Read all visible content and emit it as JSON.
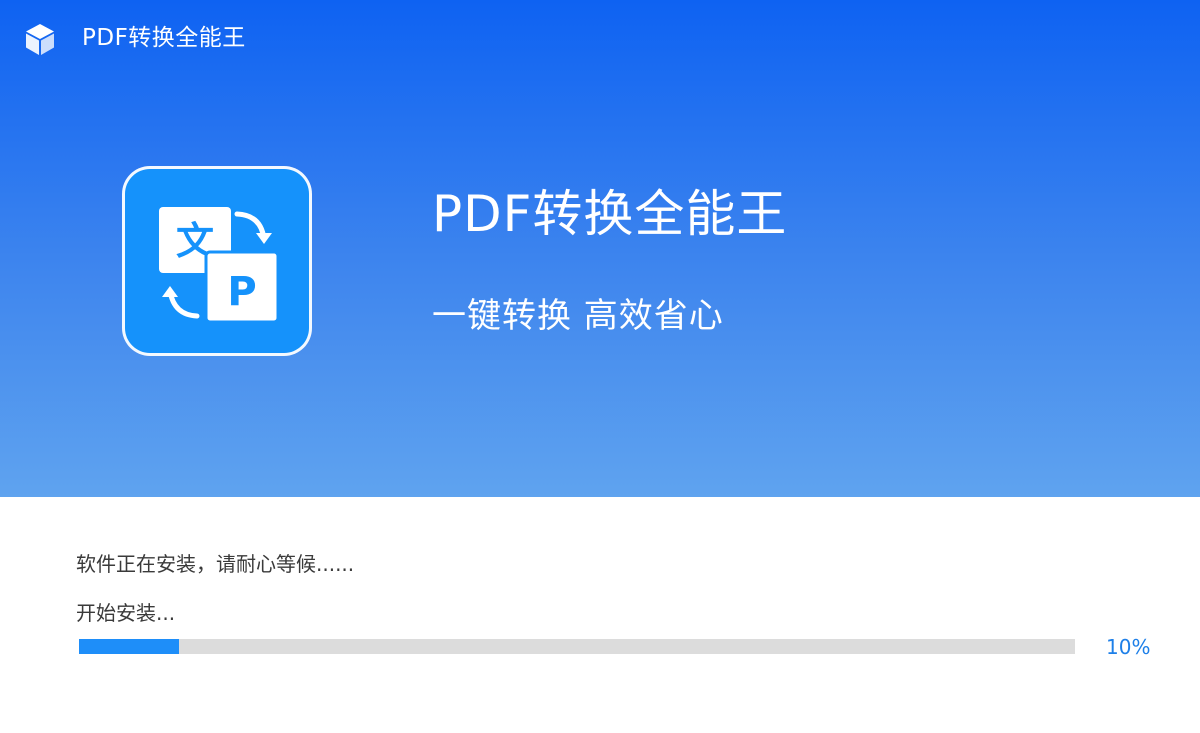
{
  "window": {
    "title": "PDF转换全能王",
    "logo_icon": "cube-icon"
  },
  "hero": {
    "product_icon": "text-to-pdf-convert-icon",
    "icon_glyph_text": "文",
    "icon_glyph_pdf": "P",
    "product_name": "PDF转换全能王",
    "slogan": "一键转换 高效省心"
  },
  "install": {
    "message": "软件正在安装，请耐心等候......",
    "step": "开始安装...",
    "progress_percent": 10,
    "progress_label": "10%"
  },
  "colors": {
    "hero_top": "#0e62f2",
    "hero_bottom": "#5fa3ef",
    "accent": "#1e8ef9",
    "progress_track": "#dcdcdc",
    "percent_text": "#1d7fe8",
    "icon_bg": "#1592fb"
  }
}
